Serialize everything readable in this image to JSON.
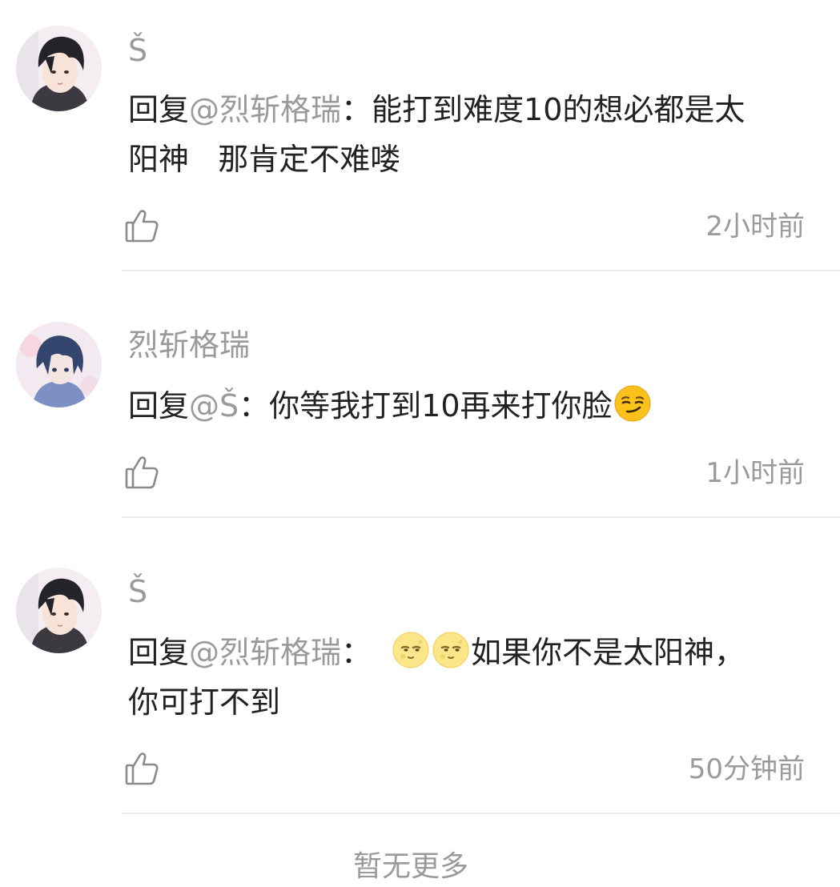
{
  "comments": [
    {
      "username": "Š",
      "reply_prefix": "回复",
      "mention": "@烈斩格瑞",
      "colon": "：",
      "text_line1": "能打到难度10的想必都是太",
      "text_line2": "阳神   那肯定不难喽",
      "time": "2小时前",
      "avatar_icon": "avatar-dark-hair-boy-icon"
    },
    {
      "username": "烈斩格瑞",
      "reply_prefix": "回复",
      "mention": "@Š",
      "colon": "：",
      "text": "你等我打到10再来打你脸",
      "emoji": "smirking-face-emoji",
      "time": "1小时前",
      "avatar_icon": "avatar-anime-blue-hair-icon"
    },
    {
      "username": "Š",
      "reply_prefix": "回复",
      "mention": "@烈斩格瑞",
      "colon": "：",
      "emoji": "full-moon-face-emoji",
      "text_after_emoji": "如果你不是太阳神，",
      "text_line2": "你可打不到",
      "time": "50分钟前",
      "avatar_icon": "avatar-dark-hair-boy-icon"
    }
  ],
  "footer_text": "暂无更多",
  "colors": {
    "primary_text": "#222222",
    "secondary_text": "#9a9a9a",
    "divider": "#ececec"
  }
}
